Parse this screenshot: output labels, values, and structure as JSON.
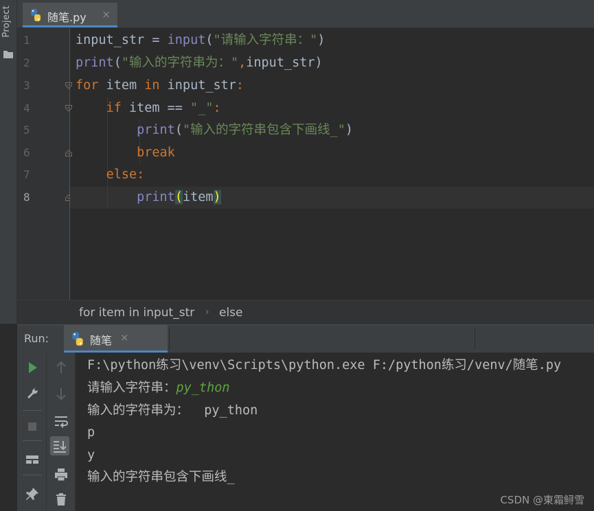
{
  "sidebar": {
    "project_label": "Project"
  },
  "editor_tab": {
    "label": "随笔.py",
    "close": "×"
  },
  "editor": {
    "line_numbers": [
      "1",
      "2",
      "3",
      "4",
      "5",
      "6",
      "7",
      "8"
    ],
    "current_line": "8",
    "lines": [
      "input_str = input(\"请输入字符串：\")",
      "print(\"输入的字符串为：\",input_str)",
      "for item in input_str:",
      "    if item == \"_\":",
      "        print(\"输入的字符串包含下画线_\")",
      "        break",
      "    else:",
      "        print(item)"
    ]
  },
  "breadcrumb": {
    "items": [
      "for item in input_str",
      "else"
    ],
    "separator": "›"
  },
  "run_panel": {
    "title": "Run:",
    "tab_label": "随笔",
    "tab_close": "×",
    "toolbar": [
      "run-icon",
      "wrench-icon",
      "stop-icon",
      "layout-icon",
      "pin-icon",
      "up-arrow-icon",
      "down-arrow-icon",
      "soft-wrap-icon",
      "scroll-to-end-icon",
      "print-icon",
      "trash-icon"
    ]
  },
  "console": {
    "command": "F:\\python练习\\venv\\Scripts\\python.exe F:/python练习/venv/随笔.py",
    "prompt": "请输入字符串：",
    "user_input": "py_thon",
    "echo_line": "输入的字符串为：  py_thon",
    "out_1": "p",
    "out_2": "y",
    "out_3": "输入的字符串包含下画线_"
  },
  "watermark": "CSDN @東霜鲟雪",
  "colors": {
    "keyword": "#cc7832",
    "builtin": "#8888c6",
    "string": "#6a8759",
    "user_input": "#5fa53f",
    "accent": "#4a88c7"
  }
}
